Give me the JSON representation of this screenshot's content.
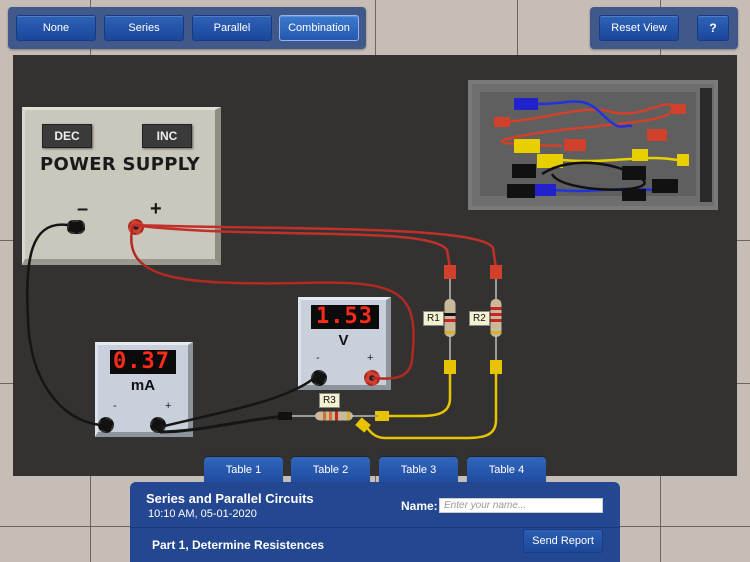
{
  "toolbar_left": {
    "buttons": [
      {
        "label": "None",
        "active": false
      },
      {
        "label": "Series",
        "active": false
      },
      {
        "label": "Parallel",
        "active": false
      },
      {
        "label": "Combination",
        "active": true
      }
    ]
  },
  "toolbar_right": {
    "reset_label": "Reset View",
    "help_label": "?"
  },
  "power_supply": {
    "dec_label": "DEC",
    "inc_label": "INC",
    "title": "POWER SUPPLY",
    "minus": "–",
    "plus": "+"
  },
  "ammeter": {
    "reading": "0.37",
    "unit": "mA",
    "minus": "-",
    "plus": "+"
  },
  "voltmeter": {
    "reading": "1.53",
    "unit": "V",
    "minus": "-",
    "plus": "+"
  },
  "resistors": [
    {
      "label": "R1",
      "bands": [
        "#c8b89a",
        "#111111",
        "#cc2222",
        "#d4b030"
      ]
    },
    {
      "label": "R2",
      "bands": [
        "#cc2222",
        "#cc2222",
        "#cc2222",
        "#d4b030"
      ]
    },
    {
      "label": "R3",
      "bands": [
        "#d07030",
        "#d07030",
        "#cc2222",
        "#d4b030"
      ]
    }
  ],
  "colors": {
    "wire_red": "#c0302a",
    "wire_black": "#151515",
    "wire_yellow": "#e8c400",
    "accent_blue": "#244792"
  },
  "tabs": [
    {
      "label": "Table 1"
    },
    {
      "label": "Table 2"
    },
    {
      "label": "Table 3"
    },
    {
      "label": "Table 4"
    }
  ],
  "report": {
    "title": "Series and Parallel Circuits",
    "timestamp": "10:10 AM, 05-01-2020",
    "part": "Part 1, Determine Resistences",
    "name_label": "Name:",
    "name_value": "",
    "name_placeholder": "Enter your name...",
    "send_label": "Send Report"
  }
}
